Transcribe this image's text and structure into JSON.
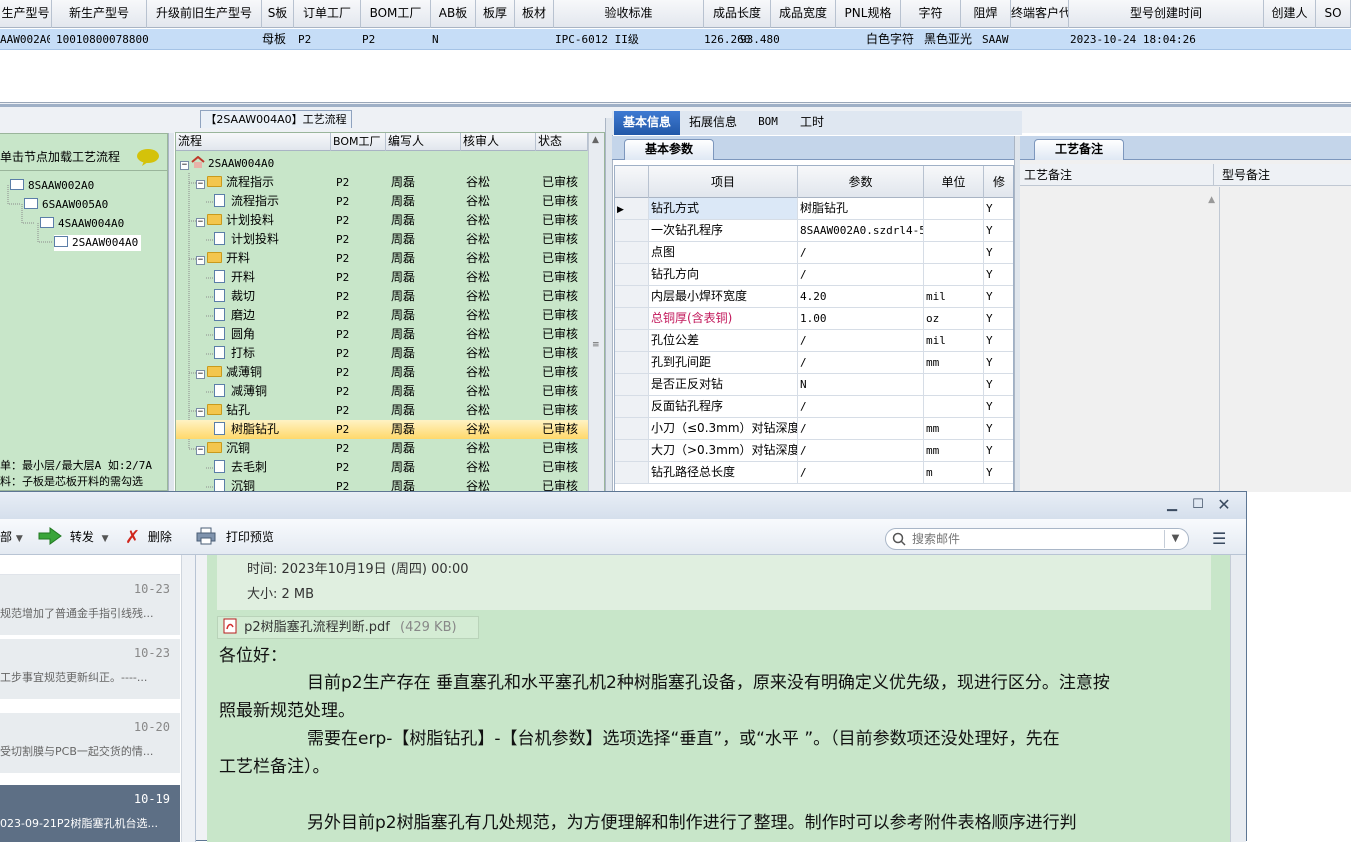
{
  "top_grid": {
    "headers": [
      "生产型号",
      "新生产型号",
      "升级前旧生产型号",
      "S板",
      "订单工厂",
      "BOM工厂",
      "AB板",
      "板厚",
      "板材",
      "验收标准",
      "成品长度",
      "成品宽度",
      "PNL规格",
      "字符",
      "阻焊",
      "终端客户代码",
      "型号创建时间",
      "创建人",
      "SO"
    ],
    "row": {
      "prod_model": "AAW002A0",
      "new_model": "10010800078800",
      "s_board": "母板",
      "order_factory": "P2",
      "bom_factory": "P2",
      "ab_board": "N",
      "standard": "IPC-6012 II级",
      "length": "126.260",
      "width": "93.480",
      "char": "白色字符",
      "solder": "黑色亚光",
      "customer": "SAAW",
      "created": "2023-10-24 18:04:26"
    }
  },
  "left_panel": {
    "hint": "单击节点加载工艺流程",
    "nodes": [
      "8SAAW002A0",
      "6SAAW005A0",
      "4SAAW004A0",
      "2SAAW004A0"
    ],
    "footer_line1": "单：最小层/最大层A 如:2/7A",
    "footer_line2": "料：子板是芯板开料的需勾选"
  },
  "process": {
    "title": "【2SAAW004A0】工艺流程",
    "headers": [
      "流程",
      "BOM工厂",
      "编写人",
      "核审人",
      "状态"
    ],
    "root": "2SAAW004A0",
    "rows": [
      {
        "name": "流程指示",
        "factory": "P2",
        "author": "周磊",
        "reviewer": "谷松",
        "status": "已审核"
      },
      {
        "name": "流程指示",
        "factory": "P2",
        "author": "周磊",
        "reviewer": "谷松",
        "status": "已审核"
      },
      {
        "name": "计划投料",
        "factory": "P2",
        "author": "周磊",
        "reviewer": "谷松",
        "status": "已审核"
      },
      {
        "name": "计划投料",
        "factory": "P2",
        "author": "周磊",
        "reviewer": "谷松",
        "status": "已审核"
      },
      {
        "name": "开料",
        "factory": "P2",
        "author": "周磊",
        "reviewer": "谷松",
        "status": "已审核"
      },
      {
        "name": "开料",
        "factory": "P2",
        "author": "周磊",
        "reviewer": "谷松",
        "status": "已审核"
      },
      {
        "name": "裁切",
        "factory": "P2",
        "author": "周磊",
        "reviewer": "谷松",
        "status": "已审核"
      },
      {
        "name": "磨边",
        "factory": "P2",
        "author": "周磊",
        "reviewer": "谷松",
        "status": "已审核"
      },
      {
        "name": "圆角",
        "factory": "P2",
        "author": "周磊",
        "reviewer": "谷松",
        "status": "已审核"
      },
      {
        "name": "打标",
        "factory": "P2",
        "author": "周磊",
        "reviewer": "谷松",
        "status": "已审核"
      },
      {
        "name": "减薄铜",
        "factory": "P2",
        "author": "周磊",
        "reviewer": "谷松",
        "status": "已审核"
      },
      {
        "name": "减薄铜",
        "factory": "P2",
        "author": "周磊",
        "reviewer": "谷松",
        "status": "已审核"
      },
      {
        "name": "钻孔",
        "factory": "P2",
        "author": "周磊",
        "reviewer": "谷松",
        "status": "已审核"
      },
      {
        "name": "树脂钻孔",
        "factory": "P2",
        "author": "周磊",
        "reviewer": "谷松",
        "status": "已审核"
      },
      {
        "name": "沉铜",
        "factory": "P2",
        "author": "周磊",
        "reviewer": "谷松",
        "status": "已审核"
      },
      {
        "name": "去毛刺",
        "factory": "P2",
        "author": "周磊",
        "reviewer": "谷松",
        "status": "已审核"
      },
      {
        "name": "沉铜",
        "factory": "P2",
        "author": "周磊",
        "reviewer": "谷松",
        "status": "已审核"
      }
    ]
  },
  "info": {
    "tabs": [
      "基本信息",
      "拓展信息",
      "BOM",
      "工时"
    ],
    "subtab": "基本参数",
    "headers": [
      "项目",
      "参数",
      "单位",
      "修"
    ],
    "rows": [
      {
        "item": "钻孔方式",
        "param": "树脂钻孔",
        "unit": "",
        "mod": "Y"
      },
      {
        "item": "一次钻孔程序",
        "param": "8SAAW002A0.szdrl4-5",
        "unit": "",
        "mod": "Y"
      },
      {
        "item": "点图",
        "param": "/",
        "unit": "",
        "mod": "Y"
      },
      {
        "item": "钻孔方向",
        "param": "/",
        "unit": "",
        "mod": "Y"
      },
      {
        "item": "内层最小焊环宽度",
        "param": "4.20",
        "unit": "mil",
        "mod": "Y"
      },
      {
        "item": "总铜厚(含表铜)",
        "param": "1.00",
        "unit": "oz",
        "mod": "Y"
      },
      {
        "item": "孔位公差",
        "param": "/",
        "unit": "mil",
        "mod": "Y"
      },
      {
        "item": "孔到孔间距",
        "param": "/",
        "unit": "mm",
        "mod": "Y"
      },
      {
        "item": "是否正反对钻",
        "param": "N",
        "unit": "",
        "mod": "Y"
      },
      {
        "item": "反面钻孔程序",
        "param": "/",
        "unit": "",
        "mod": "Y"
      },
      {
        "item": "小刀（≤0.3mm）对钻深度",
        "param": "/",
        "unit": "mm",
        "mod": "Y"
      },
      {
        "item": "大刀（>0.3mm）对钻深度",
        "param": "/",
        "unit": "mm",
        "mod": "Y"
      },
      {
        "item": "钻孔路径总长度",
        "param": "/",
        "unit": "m",
        "mod": "Y"
      }
    ],
    "highlight_color": "#c2185b"
  },
  "notes": {
    "tab": "工艺备注",
    "col1": "工艺备注",
    "col2": "型号备注"
  },
  "mail": {
    "toolbar": {
      "all_label": "部",
      "forward_label": "转发",
      "delete_label": "删除",
      "print_label": "打印预览",
      "search_placeholder": "搜索邮件"
    },
    "list": [
      {
        "date": "10-23",
        "preview": "规范增加了普通金手指引线残..."
      },
      {
        "date": "10-23",
        "preview": "工步事宜规范更新纠正。----..."
      },
      {
        "date": "10-20",
        "preview": "受切割膜与PCB一起交货的情..."
      },
      {
        "date": "10-19",
        "preview": "023-09-21P2树脂塞孔机台选..."
      }
    ],
    "time_line": "时间: 2023年10月19日 (周四) 00:00",
    "size_line": "大小: 2 MB",
    "attachment": "p2树脂塞孔流程判断.pdf",
    "attachment_size": "(429 KB)",
    "greeting": "各位好：",
    "para1a": "目前p2生产存在 垂直塞孔和水平塞孔机2种树脂塞孔设备，原来没有明确定义优先级，现进行区分。注意按",
    "para1b": "照最新规范处理。",
    "para2a": "需要在erp-【树脂钻孔】-【台机参数】选项选择“垂直”，或“水平 ”。（目前参数项还没处理好，先在",
    "para2b": "工艺栏备注）。",
    "para3": "另外目前p2树脂塞孔有几处规范，为方便理解和制作进行了整理。制作时可以参考附件表格顺序进行判"
  }
}
